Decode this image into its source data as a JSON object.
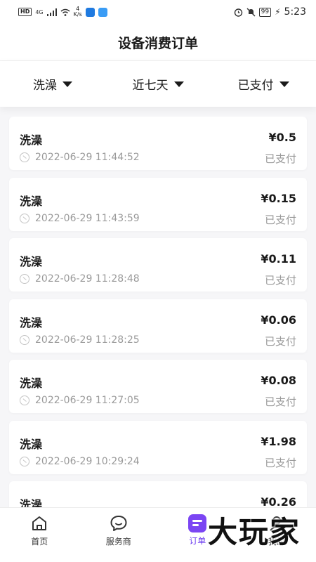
{
  "status_bar": {
    "hd": "HD",
    "network": "4G",
    "speed_value": "4",
    "speed_unit": "K/s",
    "battery": "99",
    "time": "5:23"
  },
  "header": {
    "title": "设备消费订单"
  },
  "filters": [
    {
      "label": "洗澡"
    },
    {
      "label": "近七天"
    },
    {
      "label": "已支付"
    }
  ],
  "orders": [
    {
      "name": "洗澡",
      "amount": "¥0.5",
      "time": "2022-06-29 11:44:52",
      "status": "已支付"
    },
    {
      "name": "洗澡",
      "amount": "¥0.15",
      "time": "2022-06-29 11:43:59",
      "status": "已支付"
    },
    {
      "name": "洗澡",
      "amount": "¥0.11",
      "time": "2022-06-29 11:28:48",
      "status": "已支付"
    },
    {
      "name": "洗澡",
      "amount": "¥0.06",
      "time": "2022-06-29 11:28:25",
      "status": "已支付"
    },
    {
      "name": "洗澡",
      "amount": "¥0.08",
      "time": "2022-06-29 11:27:05",
      "status": "已支付"
    },
    {
      "name": "洗澡",
      "amount": "¥1.98",
      "time": "2022-06-29 10:29:24",
      "status": "已支付"
    },
    {
      "name": "洗澡",
      "amount": "¥0.26",
      "time": "",
      "status": ""
    }
  ],
  "bottom_nav": [
    {
      "label": "首页",
      "icon": "home-icon"
    },
    {
      "label": "服务商",
      "icon": "chat-bubble-icon"
    },
    {
      "label": "订单",
      "icon": "order-doc-icon",
      "active": true
    },
    {
      "label": "我的",
      "icon": "profile-icon"
    }
  ],
  "watermark": "大玩家",
  "colors": {
    "accent": "#7b45f3",
    "muted_text": "#9a9a9a",
    "background": "#f6f6f8"
  }
}
